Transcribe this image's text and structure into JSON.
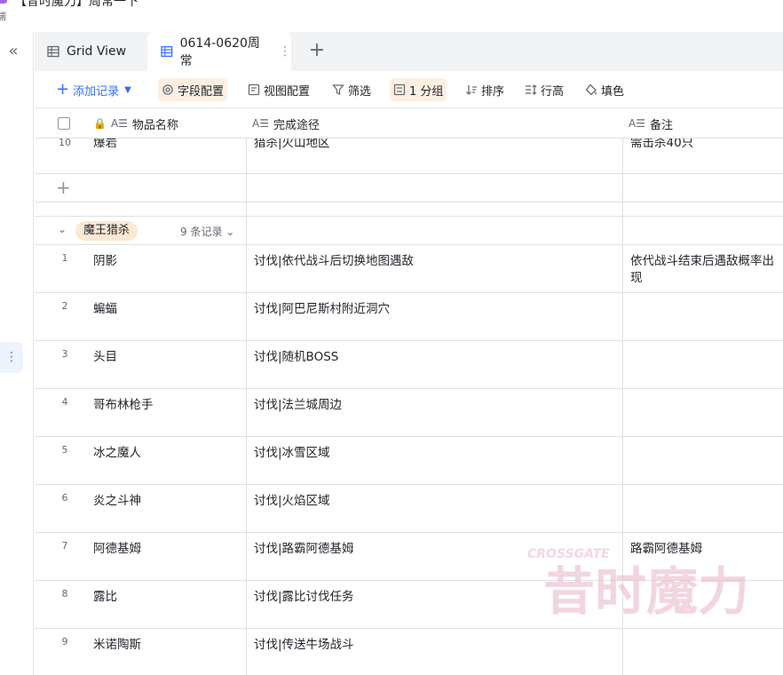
{
  "header": {
    "doc_title": "【昔时魔力】周常一下",
    "doc_sub": "端"
  },
  "tabs": [
    {
      "label": "Grid View",
      "icon": "grid-icon",
      "active": false
    },
    {
      "label": "0614-0620周常",
      "icon": "table-icon",
      "active": true
    }
  ],
  "toolbar": {
    "add_record": "添加记录",
    "field_config": "字段配置",
    "view_config": "视图配置",
    "filter": "筛选",
    "group": "1 分组",
    "sort": "排序",
    "row_height": "行高",
    "fill_color": "填色"
  },
  "columns": {
    "name": "物品名称",
    "route": "完成途径",
    "note": "备注"
  },
  "top_row": {
    "num": "10",
    "name": "爆岩",
    "route": "猎杀|火山地区",
    "note": "需击杀40只"
  },
  "group": {
    "label": "魔王猎杀",
    "count": "9 条记录"
  },
  "rows": [
    {
      "num": "1",
      "name": "阴影",
      "route": "讨伐|依代战斗后切换地图遇敌",
      "note": "依代战斗结束后遇敌概率出现"
    },
    {
      "num": "2",
      "name": "蝙蝠",
      "route": "讨伐|阿巴尼斯村附近洞穴",
      "note": ""
    },
    {
      "num": "3",
      "name": "头目",
      "route": "讨伐|随机BOSS",
      "note": ""
    },
    {
      "num": "4",
      "name": "哥布林枪手",
      "route": "讨伐|法兰城周边",
      "note": ""
    },
    {
      "num": "5",
      "name": "冰之魔人",
      "route": "讨伐|冰雪区域",
      "note": ""
    },
    {
      "num": "6",
      "name": "炎之斗神",
      "route": "讨伐|火焰区域",
      "note": ""
    },
    {
      "num": "7",
      "name": "阿德基姆",
      "route": "讨伐|路霸阿德基姆",
      "note": "路霸阿德基姆"
    },
    {
      "num": "8",
      "name": "露比",
      "route": "讨伐|露比讨伐任务",
      "note": ""
    },
    {
      "num": "9",
      "name": "米诺陶斯",
      "route": "讨伐|传送牛场战斗",
      "note": ""
    }
  ],
  "watermark": {
    "text": "昔时魔力",
    "sub": "CROSSGATE"
  },
  "colors": {
    "accent": "#3370ff",
    "group_tag": "#fce8d3",
    "highlight_btn": "#fdf0e3",
    "watermark": "#e8b4c8"
  }
}
